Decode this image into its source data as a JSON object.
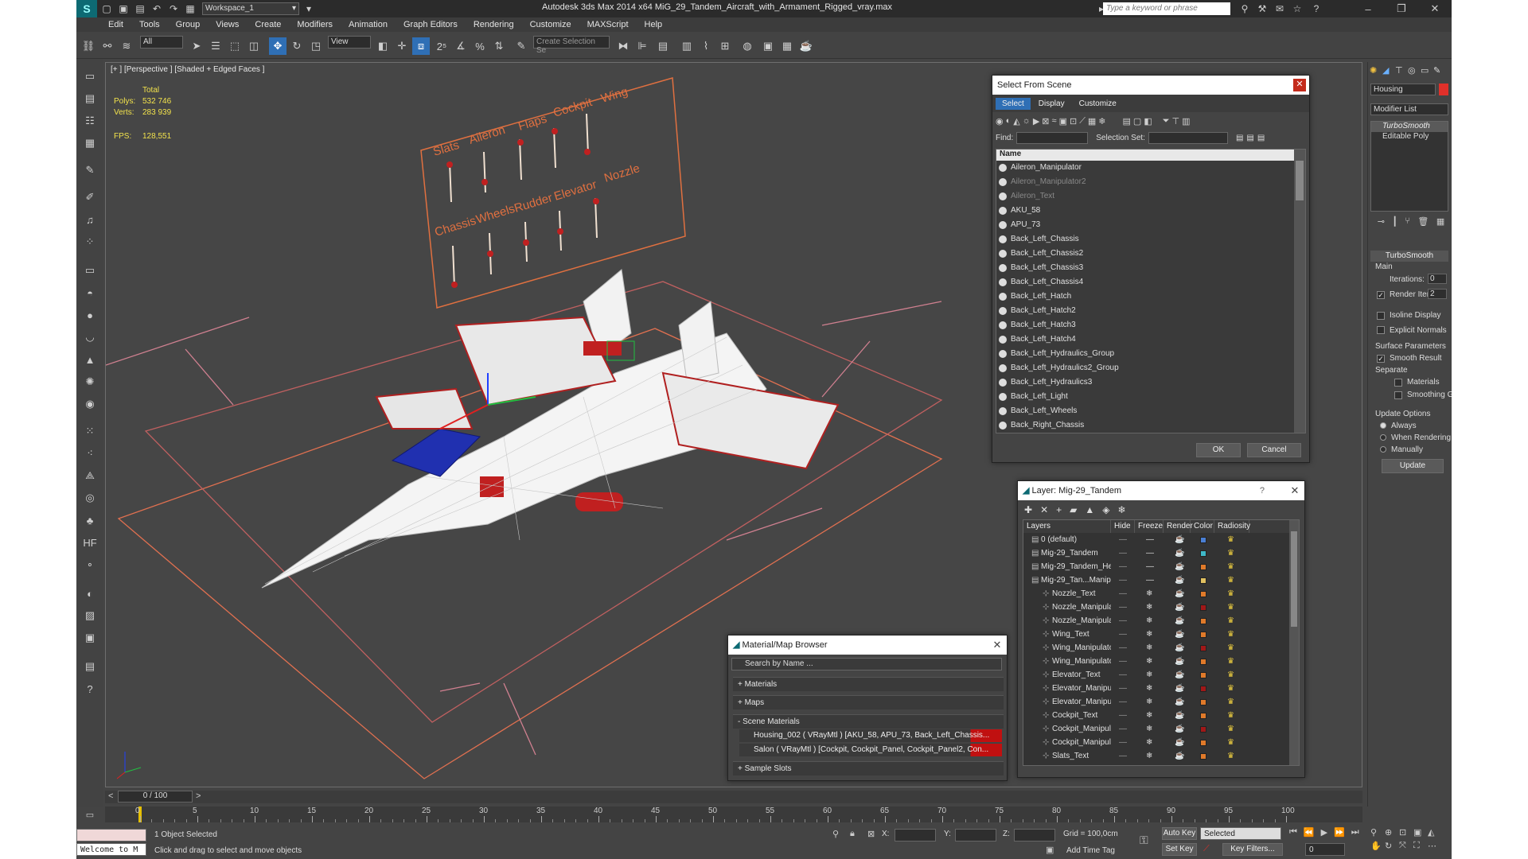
{
  "window": {
    "title": "Autodesk 3ds Max  2014 x64      MiG_29_Tandem_Aircraft_with_Armament_Rigged_vray.max",
    "workspace": "Workspace_1",
    "search_placeholder": "Type a keyword or phrase"
  },
  "menu": [
    "Edit",
    "Tools",
    "Group",
    "Views",
    "Create",
    "Modifiers",
    "Animation",
    "Graph Editors",
    "Rendering",
    "Customize",
    "MAXScript",
    "Help"
  ],
  "toolbar": {
    "selection_filter": "All",
    "ref_coord": "View",
    "named_selection_placeholder": "Create Selection Se"
  },
  "viewport": {
    "label": "[+ ] [Perspective ] [Shaded + Edged Faces ]",
    "stats": {
      "total_label": "Total",
      "polys_label": "Polys:",
      "polys_value": "532 746",
      "verts_label": "Verts:",
      "verts_value": "283 939",
      "fps_label": "FPS:",
      "fps_value": "128,551"
    },
    "panel_labels_top": [
      "Slats",
      "Aileron",
      "Flaps",
      "Cockpit",
      "Wing"
    ],
    "panel_labels_bottom": [
      "Chassis",
      "Wheels",
      "Rudder",
      "Elevator",
      "Nozzle"
    ]
  },
  "select_from_scene": {
    "title": "Select From Scene",
    "tabs": [
      "Select",
      "Display",
      "Customize"
    ],
    "find_label": "Find:",
    "selection_set_label": "Selection Set:",
    "column_name": "Name",
    "items": [
      {
        "name": "Aileron_Manipulator",
        "dim": false
      },
      {
        "name": "Aileron_Manipulator2",
        "dim": true
      },
      {
        "name": "Aileron_Text",
        "dim": true
      },
      {
        "name": "AKU_58",
        "dim": false
      },
      {
        "name": "APU_73",
        "dim": false
      },
      {
        "name": "Back_Left_Chassis",
        "dim": false
      },
      {
        "name": "Back_Left_Chassis2",
        "dim": false
      },
      {
        "name": "Back_Left_Chassis3",
        "dim": false
      },
      {
        "name": "Back_Left_Chassis4",
        "dim": false
      },
      {
        "name": "Back_Left_Hatch",
        "dim": false
      },
      {
        "name": "Back_Left_Hatch2",
        "dim": false
      },
      {
        "name": "Back_Left_Hatch3",
        "dim": false
      },
      {
        "name": "Back_Left_Hatch4",
        "dim": false
      },
      {
        "name": "Back_Left_Hydraulics_Group",
        "dim": false
      },
      {
        "name": "Back_Left_Hydraulics2_Group",
        "dim": false
      },
      {
        "name": "Back_Left_Hydraulics3",
        "dim": false
      },
      {
        "name": "Back_Left_Light",
        "dim": false
      },
      {
        "name": "Back_Left_Wheels",
        "dim": false
      },
      {
        "name": "Back_Right_Chassis",
        "dim": false
      }
    ],
    "ok_label": "OK",
    "cancel_label": "Cancel"
  },
  "layer_dialog": {
    "title": "Layer: Mig-29_Tandem",
    "help": "?",
    "columns": [
      "Layers",
      "Hide",
      "Freeze",
      "Render",
      "Color",
      "Radiosity"
    ],
    "rows": [
      {
        "name": "0 (default)",
        "indent": 0,
        "color": "#4a7fd4"
      },
      {
        "name": "Mig-29_Tandem",
        "indent": 0,
        "color": "#3fb8c8"
      },
      {
        "name": "Mig-29_Tandem_He",
        "indent": 0,
        "color": "#e07a2a"
      },
      {
        "name": "Mig-29_Tan...Manip",
        "indent": 0,
        "color": "#e0c060"
      },
      {
        "name": "Nozzle_Text",
        "indent": 1,
        "color": "#e07a2a"
      },
      {
        "name": "Nozzle_Manipula",
        "indent": 1,
        "color": "#a01818"
      },
      {
        "name": "Nozzle_Manipula",
        "indent": 1,
        "color": "#e07a2a"
      },
      {
        "name": "Wing_Text",
        "indent": 1,
        "color": "#e07a2a"
      },
      {
        "name": "Wing_Manipulatc",
        "indent": 1,
        "color": "#a01818"
      },
      {
        "name": "Wing_Manipulatc",
        "indent": 1,
        "color": "#e07a2a"
      },
      {
        "name": "Elevator_Text",
        "indent": 1,
        "color": "#e07a2a"
      },
      {
        "name": "Elevator_Manipu",
        "indent": 1,
        "color": "#a01818"
      },
      {
        "name": "Elevator_Manipu",
        "indent": 1,
        "color": "#e07a2a"
      },
      {
        "name": "Cockpit_Text",
        "indent": 1,
        "color": "#e07a2a"
      },
      {
        "name": "Cockpit_Manipul",
        "indent": 1,
        "color": "#a01818"
      },
      {
        "name": "Cockpit_Manipul",
        "indent": 1,
        "color": "#e07a2a"
      },
      {
        "name": "Slats_Text",
        "indent": 1,
        "color": "#e07a2a"
      }
    ]
  },
  "material_browser": {
    "title": "Material/Map Browser",
    "search_placeholder": "Search by Name ...",
    "sections": [
      "+ Materials",
      "+ Maps",
      "- Scene Materials"
    ],
    "scene_materials": [
      "Housing_002  ( VRayMtl )  [AKU_58, APU_73, Back_Left_Chassis...",
      "Salon  ( VRayMtl )  [Cockpit, Cockpit_Panel, Cockpit_Panel2, Con..."
    ],
    "sample_slots": "+ Sample Slots"
  },
  "command_panel": {
    "object_name": "Housing",
    "modifier_list": "Modifier List",
    "stack": [
      "TurboSmooth",
      "Editable Poly"
    ],
    "rollout_title": "TurboSmooth",
    "main_label": "Main",
    "iterations_label": "Iterations:",
    "iterations_value": "0",
    "render_iters_label": "Render Iters:",
    "render_iters_value": "2",
    "isoline_label": "Isoline Display",
    "explicit_normals_label": "Explicit Normals",
    "surface_params_label": "Surface Parameters",
    "smooth_result_label": "Smooth Result",
    "separate_label": "Separate",
    "materials_label": "Materials",
    "smoothing_groups_label": "Smoothing Groups",
    "update_options_label": "Update Options",
    "always_label": "Always",
    "when_rendering_label": "When Rendering",
    "manually_label": "Manually",
    "update_button": "Update",
    "accent_color": "#e0302a"
  },
  "timeline": {
    "frame": "0 / 100",
    "ticks": [
      "0",
      "5",
      "10",
      "15",
      "20",
      "25",
      "30",
      "35",
      "40",
      "45",
      "50",
      "55",
      "60",
      "65",
      "70",
      "75",
      "80",
      "85",
      "90",
      "95",
      "100"
    ]
  },
  "status": {
    "script_listener": "Welcome to M",
    "selected": "1 Object Selected",
    "prompt": "Click and drag to select and move objects",
    "x_label": "X:",
    "y_label": "Y:",
    "z_label": "Z:",
    "grid": "Grid = 100,0cm",
    "add_time_tag": "Add Time Tag",
    "auto_key": "Auto Key",
    "set_key": "Set Key",
    "selected_dropdown": "Selected",
    "key_filters": "Key Filters...",
    "frame_value": "0"
  }
}
